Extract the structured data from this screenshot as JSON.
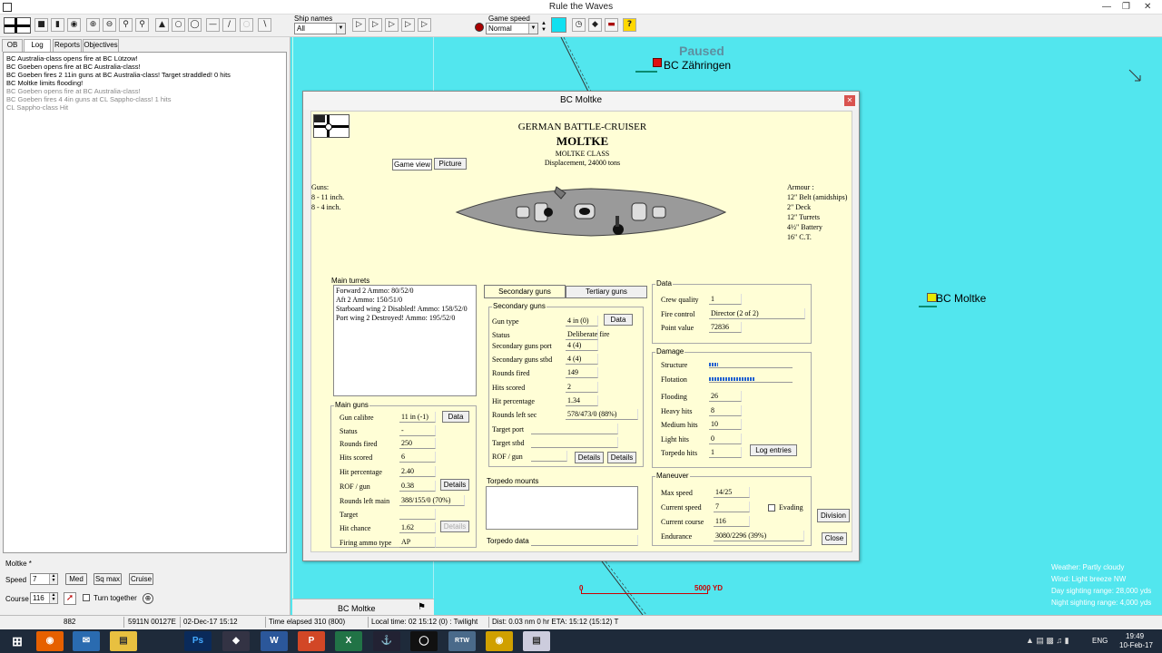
{
  "window": {
    "title": "Rule the Waves"
  },
  "toolbar": {
    "ship_names_label": "Ship names",
    "ship_names_value": "All",
    "game_speed_label": "Game speed",
    "game_speed_value": "Normal",
    "help": "?"
  },
  "left": {
    "tabs": [
      "OB",
      "Log",
      "Reports",
      "Objectives"
    ],
    "log": [
      "BC Australia-class opens fire at BC Lützow!",
      "BC Goeben opens fire at BC Australia-class!",
      "BC Goeben fires 2 11in guns at BC Australia-class! Target straddled!  0 hits",
      "BC Moltke limits flooding!",
      "BC Goeben opens fire at BC Australia-class!",
      "BC Goeben fires 4 4in guns at CL Sappho-class! 1 hits",
      "CL Sappho-class Hit"
    ],
    "ship_label": "Moltke *",
    "speed_label": "Speed",
    "speed_value": "7",
    "btn_med": "Med",
    "btn_sqmax": "Sq max",
    "btn_cruise": "Cruise",
    "course_label": "Course",
    "course_value": "116",
    "turn_together": "Turn together",
    "bottom_label": "BC Moltke"
  },
  "map": {
    "paused": "Paused",
    "ship1": "BC Zähringen",
    "ship2": "BC Moltke",
    "scale_zero": "0",
    "scale_end": "5000 YD",
    "weather": "Weather: Partly cloudy",
    "wind": "Wind: Light breeze  NW",
    "day_sight": "Day sighting range: 28,000 yds",
    "night_sight": "Night sighting range: 4,000 yds"
  },
  "dialog": {
    "title": "BC Moltke",
    "heading": "GERMAN BATTLE-CRUISER",
    "name": "MOLTKE",
    "class": "MOLTKE CLASS",
    "displacement": "Displacement, 24000 tons",
    "tab_game": "Game view",
    "tab_picture": "Picture",
    "guns_title": "Guns:",
    "guns": [
      "8 - 11 inch.",
      "8 - 4 inch."
    ],
    "armour_title": "Armour :",
    "armour": [
      "12\" Belt (amidships)",
      "2\" Deck",
      "12\" Turrets",
      "4½\" Battery",
      "16\" C.T."
    ],
    "main_turrets_label": "Main turrets",
    "main_turrets": [
      "Forward 2 Ammo: 80/52/0",
      "Aft 2 Ammo: 150/51/0",
      "Starboard wing 2 Disabled! Ammo: 158/52/0",
      "Port wing 2 Destroyed! Ammo: 195/52/0"
    ],
    "main_guns": {
      "legend": "Main guns",
      "rows": [
        {
          "label": "Gun calibre",
          "value": "11 in (-1)"
        },
        {
          "label": "Status",
          "value": "-"
        },
        {
          "label": "Rounds fired",
          "value": "250"
        },
        {
          "label": "Hits scored",
          "value": "6"
        },
        {
          "label": "Hit percentage",
          "value": "2.40"
        },
        {
          "label": "ROF / gun",
          "value": "0.38"
        },
        {
          "label": "Rounds left main",
          "value": "388/155/0 (70%)"
        },
        {
          "label": "Target",
          "value": ""
        },
        {
          "label": "Hit chance",
          "value": "1.62"
        },
        {
          "label": "Firing ammo type",
          "value": "AP"
        }
      ],
      "data_btn": "Data",
      "details_btn": "Details",
      "details_btn2": "Details"
    },
    "sec_tab": "Secondary guns",
    "ter_tab": "Tertiary guns",
    "secondary": {
      "legend": "Secondary guns",
      "rows": [
        {
          "label": "Gun type",
          "value": "4 in (0)"
        },
        {
          "label": "Status",
          "value": "Deliberate fire"
        },
        {
          "label": "Secondary guns port",
          "value": "4 (4)"
        },
        {
          "label": "Secondary guns stbd",
          "value": "4 (4)"
        },
        {
          "label": "Rounds fired",
          "value": "149"
        },
        {
          "label": "Hits scored",
          "value": "2"
        },
        {
          "label": "Hit percentage",
          "value": "1.34"
        },
        {
          "label": "Rounds left sec",
          "value": "578/473/0 (88%)"
        },
        {
          "label": "Target port",
          "value": ""
        },
        {
          "label": "Target stbd",
          "value": ""
        },
        {
          "label": "ROF / gun",
          "value": ""
        }
      ],
      "data_btn": "Data",
      "details1": "Details",
      "details2": "Details"
    },
    "torpedo_mounts": "Torpedo mounts",
    "torpedo_data": "Torpedo data",
    "data_section": {
      "legend": "Data",
      "rows": [
        {
          "label": "Crew quality",
          "value": "1"
        },
        {
          "label": "Fire control",
          "value": "Director (2 of 2)"
        },
        {
          "label": "Point value",
          "value": "72836"
        }
      ]
    },
    "damage": {
      "legend": "Damage",
      "structure_label": "Structure",
      "structure_level": 0.11,
      "flotation_label": "Flotation",
      "flotation_level": 0.55,
      "rows": [
        {
          "label": "Flooding",
          "value": "26"
        },
        {
          "label": "Heavy hits",
          "value": "8"
        },
        {
          "label": "Medium hits",
          "value": "10"
        },
        {
          "label": "Light hits",
          "value": "0"
        },
        {
          "label": "Torpedo hits",
          "value": "1"
        }
      ],
      "log_btn": "Log entries"
    },
    "maneuver": {
      "legend": "Maneuver",
      "rows": [
        {
          "label": "Max speed",
          "value": "14/25"
        },
        {
          "label": "Current speed",
          "value": "7"
        },
        {
          "label": "Current course",
          "value": "116"
        },
        {
          "label": "Endurance",
          "value": "3080/2296 (39%)"
        }
      ],
      "evading": "Evading"
    },
    "division_btn": "Division",
    "close_btn": "Close"
  },
  "status": {
    "c1": "882",
    "c2": "5911N 00127E",
    "c3": "02-Dec-17 15:12",
    "c4": "Time elapsed 310 (800)",
    "c5": "Local time: 02 15:12 (0) : Twilight",
    "c6": "Dist: 0.03 nm 0 hr ETA: 15:12 (15:12) T"
  },
  "taskbar": {
    "lang": "ENG",
    "time": "19:49",
    "date": "10-Feb-17"
  },
  "colors": {
    "sea": "#52e6ee",
    "panel": "#fffed6",
    "ship_marker": "#e8e800",
    "enemy_marker": "#e01010"
  }
}
